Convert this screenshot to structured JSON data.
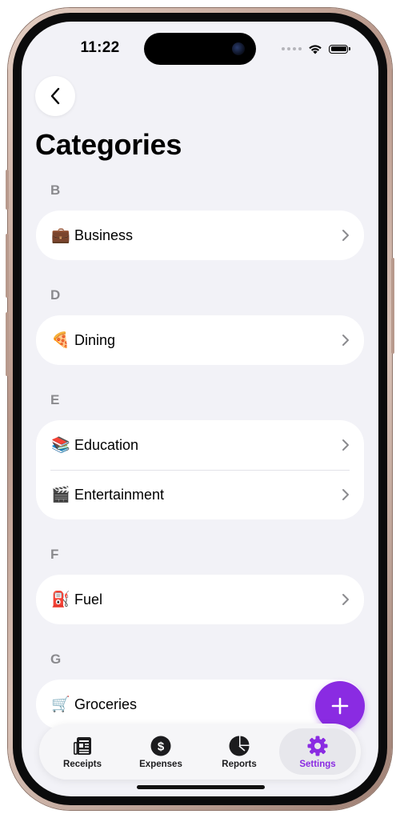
{
  "status_bar": {
    "time": "11:22"
  },
  "nav": {
    "back_icon": "chevron-left-icon"
  },
  "page_title": "Categories",
  "sections": [
    {
      "letter": "B",
      "items": [
        {
          "emoji": "💼",
          "label": "Business"
        }
      ]
    },
    {
      "letter": "D",
      "items": [
        {
          "emoji": "🍕",
          "label": "Dining"
        }
      ]
    },
    {
      "letter": "E",
      "items": [
        {
          "emoji": "📚",
          "label": "Education"
        },
        {
          "emoji": "🎬",
          "label": "Entertainment"
        }
      ]
    },
    {
      "letter": "F",
      "items": [
        {
          "emoji": "⛽",
          "label": "Fuel"
        }
      ]
    },
    {
      "letter": "G",
      "items": [
        {
          "emoji": "🛒",
          "label": "Groceries"
        }
      ]
    }
  ],
  "fab": {
    "icon": "plus-icon"
  },
  "tabs": [
    {
      "label": "Receipts",
      "icon": "receipt-icon",
      "active": false
    },
    {
      "label": "Expenses",
      "icon": "dollar-icon",
      "active": false
    },
    {
      "label": "Reports",
      "icon": "pie-chart-icon",
      "active": false
    },
    {
      "label": "Settings",
      "icon": "gear-icon",
      "active": true
    }
  ],
  "colors": {
    "accent": "#8a2be2",
    "background": "#f2f2f7",
    "card": "#ffffff",
    "section_letter": "#8a8a8e"
  }
}
